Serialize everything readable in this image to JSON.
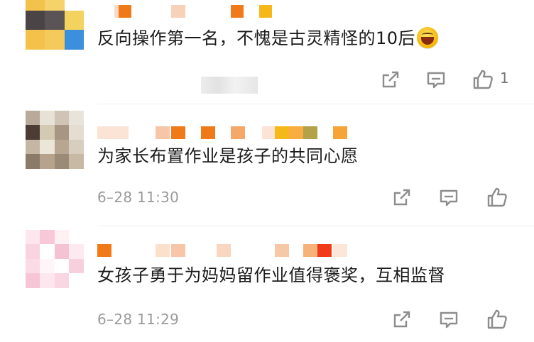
{
  "comments": [
    {
      "text": "反向操作第一名，不愧是古灵精怪的10后",
      "emoji": "laughing-face",
      "time": "",
      "likes": "1"
    },
    {
      "text": "为家长布置作业是孩子的共同心愿",
      "time": "6–28 11:30",
      "likes": ""
    },
    {
      "text": "女孩子勇于为妈妈留作业值得褒奖，互相监督",
      "time": "6–28 11:29",
      "likes": ""
    }
  ],
  "icons": {
    "share": "share-icon",
    "comment": "comment-icon",
    "like": "thumbs-up-icon"
  },
  "colors": {
    "nickname_orange": "#f07a1a",
    "nickname_light": "#f7cfb0",
    "nickname_yellow": "#f6b818",
    "icon_gray": "#8d8d8d"
  }
}
